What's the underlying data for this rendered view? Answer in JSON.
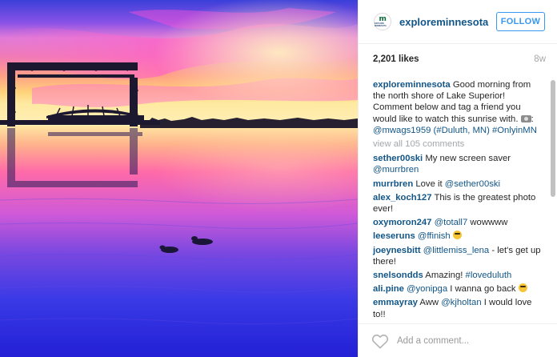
{
  "post": {
    "username": "exploreminnesota",
    "follow_label": "FOLLOW",
    "likes": "2,201 likes",
    "time_ago": "8w",
    "avatar_letter": "m",
    "avatar_sub": "EXPLORE MINNESOTA",
    "caption": {
      "user": "exploreminnesota",
      "text": "Good morning from the north shore of Lake Superior! Comment below and tag a friend you would like to watch this sunrise with.",
      "emoji": "camera-icon",
      "mention": "@mwags1959",
      "hashtag1": "(#Duluth, MN)",
      "hashtag2": "#OnlyinMN"
    },
    "view_all": "view all 105 comments",
    "add_comment_placeholder": "Add a comment..."
  },
  "comments": [
    {
      "user": "sether00ski",
      "pre": "My new screen saver",
      "link": "@murrbren",
      "post": ""
    },
    {
      "user": "murrbren",
      "pre": "Love it",
      "link": "@sether00ski",
      "post": ""
    },
    {
      "user": "alex_koch127",
      "pre": "This is the greatest photo ever!",
      "link": "",
      "post": ""
    },
    {
      "user": "oxymoron247",
      "pre": "",
      "link": "@totall7",
      "post": "wowwww"
    },
    {
      "user": "leeseruns",
      "pre": "",
      "link": "@ffinish",
      "post": ""
    },
    {
      "user": "joeynesbitt",
      "pre": "",
      "link": "@littlemiss_lena",
      "post": "- let's get up there!"
    },
    {
      "user": "snelsondds",
      "pre": "Amazing!",
      "link": "#loveduluth",
      "post": ""
    },
    {
      "user": "ali.pine",
      "pre": "",
      "link": "@yonipga",
      "post": "I wanna go back"
    },
    {
      "user": "emmayray",
      "pre": "Aww",
      "link": "@kjholtan",
      "post": "I would love to!!"
    }
  ],
  "comment_emojis": {
    "leeseruns": "sunglasses-emoji-icon",
    "ali.pine": "grin-emoji-icon"
  },
  "colors": {
    "link": "#125688",
    "button": "#3897f0",
    "muted": "#a5a7aa"
  }
}
